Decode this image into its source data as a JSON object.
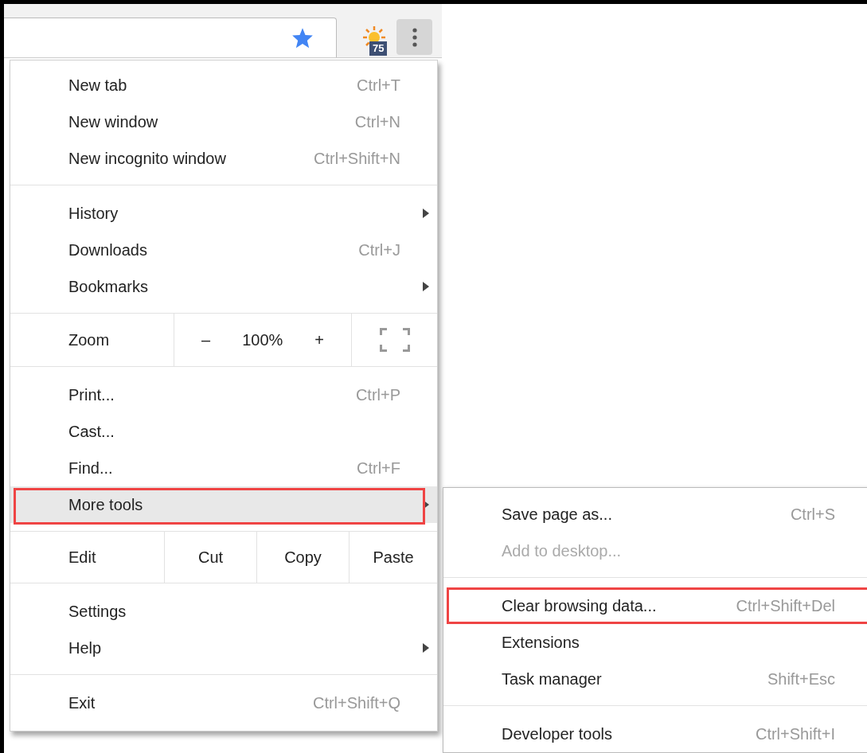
{
  "toolbar": {
    "bookmark_starred": true,
    "extension_badge": "75"
  },
  "menu": {
    "sections": [
      {
        "kind": "items",
        "items": [
          {
            "label": "New tab",
            "shortcut": "Ctrl+T",
            "has_submenu": false,
            "selected": false,
            "outlined": false
          },
          {
            "label": "New window",
            "shortcut": "Ctrl+N",
            "has_submenu": false,
            "selected": false,
            "outlined": false
          },
          {
            "label": "New incognito window",
            "shortcut": "Ctrl+Shift+N",
            "has_submenu": false,
            "selected": false,
            "outlined": false
          }
        ]
      },
      {
        "kind": "items",
        "items": [
          {
            "label": "History",
            "has_submenu": true,
            "selected": false,
            "outlined": false
          },
          {
            "label": "Downloads",
            "shortcut": "Ctrl+J",
            "has_submenu": false,
            "selected": false,
            "outlined": false
          },
          {
            "label": "Bookmarks",
            "has_submenu": true,
            "selected": false,
            "outlined": false
          }
        ]
      },
      {
        "kind": "zoom",
        "label": "Zoom",
        "minus": "–",
        "value": "100%",
        "plus": "+"
      },
      {
        "kind": "items",
        "items": [
          {
            "label": "Print...",
            "shortcut": "Ctrl+P",
            "has_submenu": false,
            "selected": false,
            "outlined": false
          },
          {
            "label": "Cast...",
            "has_submenu": false,
            "selected": false,
            "outlined": false
          },
          {
            "label": "Find...",
            "shortcut": "Ctrl+F",
            "has_submenu": false,
            "selected": false,
            "outlined": false
          },
          {
            "label": "More tools",
            "has_submenu": true,
            "selected": true,
            "outlined": true
          }
        ]
      },
      {
        "kind": "edit",
        "label": "Edit",
        "actions": [
          "Cut",
          "Copy",
          "Paste"
        ]
      },
      {
        "kind": "items",
        "items": [
          {
            "label": "Settings",
            "has_submenu": false,
            "selected": false,
            "outlined": false
          },
          {
            "label": "Help",
            "has_submenu": true,
            "selected": false,
            "outlined": false
          }
        ]
      },
      {
        "kind": "items",
        "items": [
          {
            "label": "Exit",
            "shortcut": "Ctrl+Shift+Q",
            "has_submenu": false,
            "selected": false,
            "outlined": false
          }
        ]
      }
    ]
  },
  "submenu": {
    "sections": [
      [
        {
          "label": "Save page as...",
          "shortcut": "Ctrl+S",
          "disabled": false,
          "outlined": false
        },
        {
          "label": "Add to desktop...",
          "disabled": true,
          "outlined": false
        }
      ],
      [
        {
          "label": "Clear browsing data...",
          "shortcut": "Ctrl+Shift+Del",
          "disabled": false,
          "outlined": true
        },
        {
          "label": "Extensions",
          "disabled": false,
          "outlined": false
        },
        {
          "label": "Task manager",
          "shortcut": "Shift+Esc",
          "disabled": false,
          "outlined": false
        }
      ],
      [
        {
          "label": "Developer tools",
          "shortcut": "Ctrl+Shift+I",
          "disabled": false,
          "outlined": false
        }
      ]
    ]
  }
}
